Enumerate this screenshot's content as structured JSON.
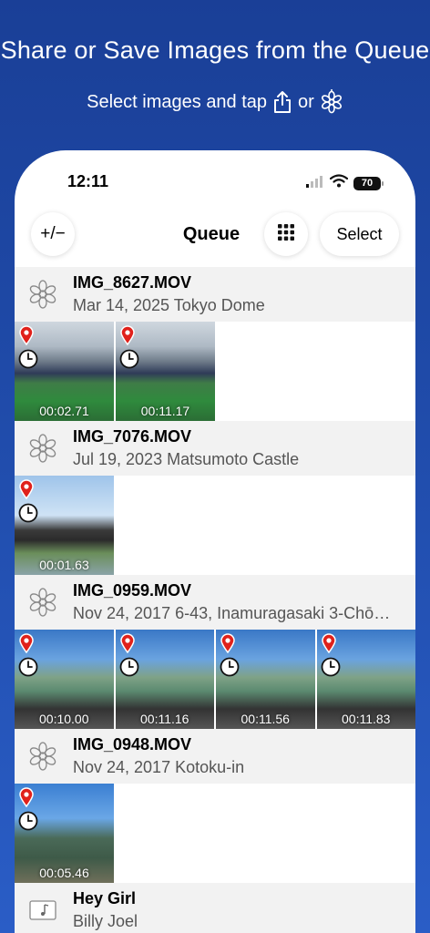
{
  "promo": {
    "title": "Share or Save Images from the Queue",
    "subtitle_prefix": "Select images and tap",
    "subtitle_or": "or"
  },
  "status_bar": {
    "time": "12:11",
    "battery": "70"
  },
  "navbar": {
    "plusminus_label": "+/−",
    "title": "Queue",
    "select_label": "Select"
  },
  "groups": [
    {
      "name": "IMG_8627.MOV",
      "desc": "Mar 14, 2025 Tokyo Dome",
      "thumbs": [
        {
          "duration": "00:02.71",
          "scene": "stadium"
        },
        {
          "duration": "00:11.17",
          "scene": "stadium"
        }
      ]
    },
    {
      "name": "IMG_7076.MOV",
      "desc": "Jul 19, 2023 Matsumoto Castle",
      "thumbs": [
        {
          "duration": "00:01.63",
          "scene": "castle"
        }
      ]
    },
    {
      "name": "IMG_0959.MOV",
      "desc": "Nov 24, 2017 6-43, Inamuragasaki 3-Chō…",
      "thumbs": [
        {
          "duration": "00:10.00",
          "scene": "train"
        },
        {
          "duration": "00:11.16",
          "scene": "train"
        },
        {
          "duration": "00:11.56",
          "scene": "train"
        },
        {
          "duration": "00:11.83",
          "scene": "train"
        }
      ]
    },
    {
      "name": "IMG_0948.MOV",
      "desc": "Nov 24, 2017 Kotoku-in",
      "thumbs": [
        {
          "duration": "00:05.46",
          "scene": "buddha"
        }
      ]
    }
  ],
  "audio_item": {
    "name": "Hey Girl",
    "desc": "Billy Joel"
  },
  "icons": {
    "share": "share-icon",
    "flower": "flower-icon",
    "pin": "location-pin-icon",
    "clock": "clock-icon",
    "grid": "grid-icon",
    "music": "music-note-icon"
  },
  "colors": {
    "background_top": "#1a3f97",
    "background_bottom": "#2a5dc6",
    "pin_red": "#e0211b"
  }
}
